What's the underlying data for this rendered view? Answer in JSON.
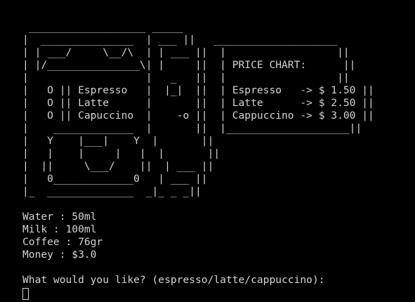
{
  "ascii_art": [
    " ___________________ _____",
    "|  _______________  | ___ ||   ____________________",
    "| | ___/     \\__/\\  | | ___ ||  |                  ||",
    "| |/_______________\\| |     ||  | PRICE CHART:      ||",
    "|                   |   _   ||  |                  ||",
    "|   O || Espresso   |  |_|  ||  | Espresso   -> $ 1.50 ||",
    "|   O || Latte      |       ||  | Latte      -> $ 2.50 ||",
    "|   O || Capuccino  |    -o ||  | Cappuccino -> $ 3.00 ||",
    "|    _____________  |       ||  |____________________||",
    "|   Y    |___|    Y  |       ||",
    "|   |    |     |   |  |       ||",
    "|  ||     \\___/    ||  | ___ ||",
    "|   0_____________0   | ___ ||",
    "|_  ______________  _|_ _ _||"
  ],
  "status": {
    "water": "Water : 50ml",
    "milk": "Milk : 100ml",
    "coffee": "Coffee : 76gr",
    "money": "Money : $3.0"
  },
  "prompt": "What would you like? (espresso/latte/cappuccino):",
  "colors": {
    "background": "#000000",
    "foreground": "#d4d4d4"
  }
}
